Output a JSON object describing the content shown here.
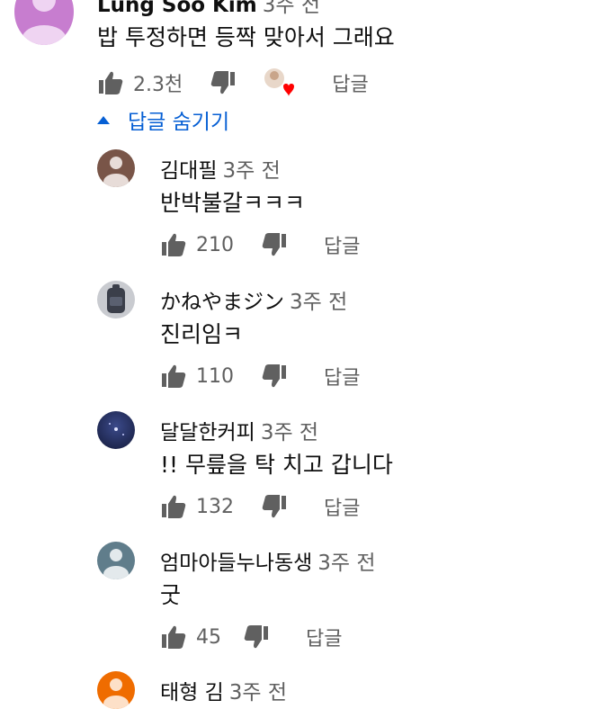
{
  "top_comment": {
    "author": "Lung Soo Kim",
    "time": "3주 전",
    "text": "밥 투정하면 등짝 맞아서 그래요",
    "likes": "2.3천",
    "reply_label": "답글"
  },
  "toggle_label": "답글 숨기기",
  "replies": [
    {
      "author": "김대필",
      "time": "3주 전",
      "text": "반박불갈ㅋㅋㅋ",
      "likes": "210",
      "reply_label": "답글"
    },
    {
      "author": "かねやまジン",
      "time": "3주 전",
      "text": "진리임ㅋ",
      "likes": "110",
      "reply_label": "답글"
    },
    {
      "author": "달달한커피",
      "time": "3주 전",
      "text": "!! 무릎을 탁 치고 갑니다",
      "likes": "132",
      "reply_label": "답글"
    },
    {
      "author": "엄마아들누나동생",
      "time": "3주 전",
      "text": "굿",
      "likes": "45",
      "reply_label": "답글"
    },
    {
      "author": "태형 김",
      "time": "3주 전"
    }
  ]
}
